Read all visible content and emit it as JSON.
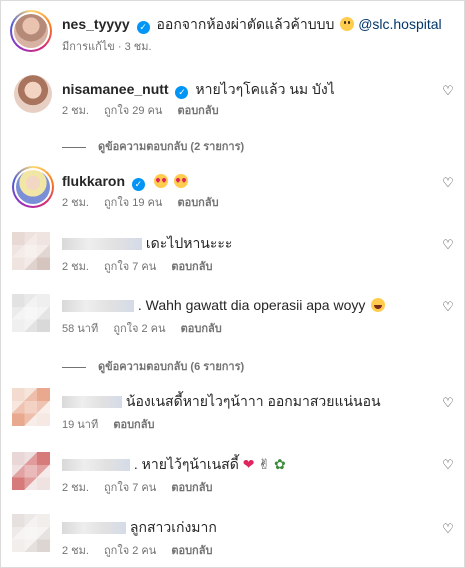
{
  "post": {
    "username": "nes_tyyyy",
    "caption": "ออกจากห้องผ่าตัดแล้วค้าบบบ",
    "mention": "@slc.hospital",
    "meta_edited": "มีการแก้ไข · 3 ชม."
  },
  "labels": {
    "likes_sep": "ถูกใจ",
    "reply": "ตอบกลับ"
  },
  "comments": [
    {
      "username": "nisamanee_nutt",
      "text": "หายไวๆโคแล้ว นม บังไ",
      "time": "2 ชม.",
      "likes": "ถูกใจ 29 คน",
      "reply": "ตอบกลับ"
    },
    {
      "username": "flukkaron",
      "text": "",
      "time": "2 ชม.",
      "likes": "ถูกใจ 19 คน",
      "reply": "ตอบกลับ"
    },
    {
      "username": "",
      "text": "เดะไปหานะะะ",
      "time": "2 ชม.",
      "likes": "ถูกใจ 7 คน",
      "reply": "ตอบกลับ"
    },
    {
      "username": "",
      "text": ". Wahh gawatt dia operasii apa woyy",
      "time": "58 นาที",
      "likes": "ถูกใจ 2 คน",
      "reply": "ตอบกลับ"
    },
    {
      "username": "",
      "text": "น้องเนสดี้หายไวๆน้าาา ออกมาสวยแน่นอน",
      "time": "19 นาที",
      "likes": "",
      "reply": "ตอบกลับ"
    },
    {
      "username": "",
      "text": ". หายไว้ๆน้าเนสดี้",
      "time": "2 ชม.",
      "likes": "ถูกใจ 7 คน",
      "reply": "ตอบกลับ"
    },
    {
      "username": "",
      "text": "ลูกสาวเก่งมาก",
      "time": "2 ชม.",
      "likes": "ถูกใจ 2 คน",
      "reply": "ตอบกลับ"
    }
  ],
  "threads": [
    {
      "label": "ดูข้อความตอบกลับ (2 รายการ)"
    },
    {
      "label": "ดูข้อความตอบกลับ (6 รายการ)"
    }
  ],
  "icons": {
    "heart": "heart-outline-icon",
    "verified": "verified-badge-icon"
  },
  "colors": {
    "verified": "#0095f6",
    "mention": "#00376b",
    "meta": "#737373"
  }
}
